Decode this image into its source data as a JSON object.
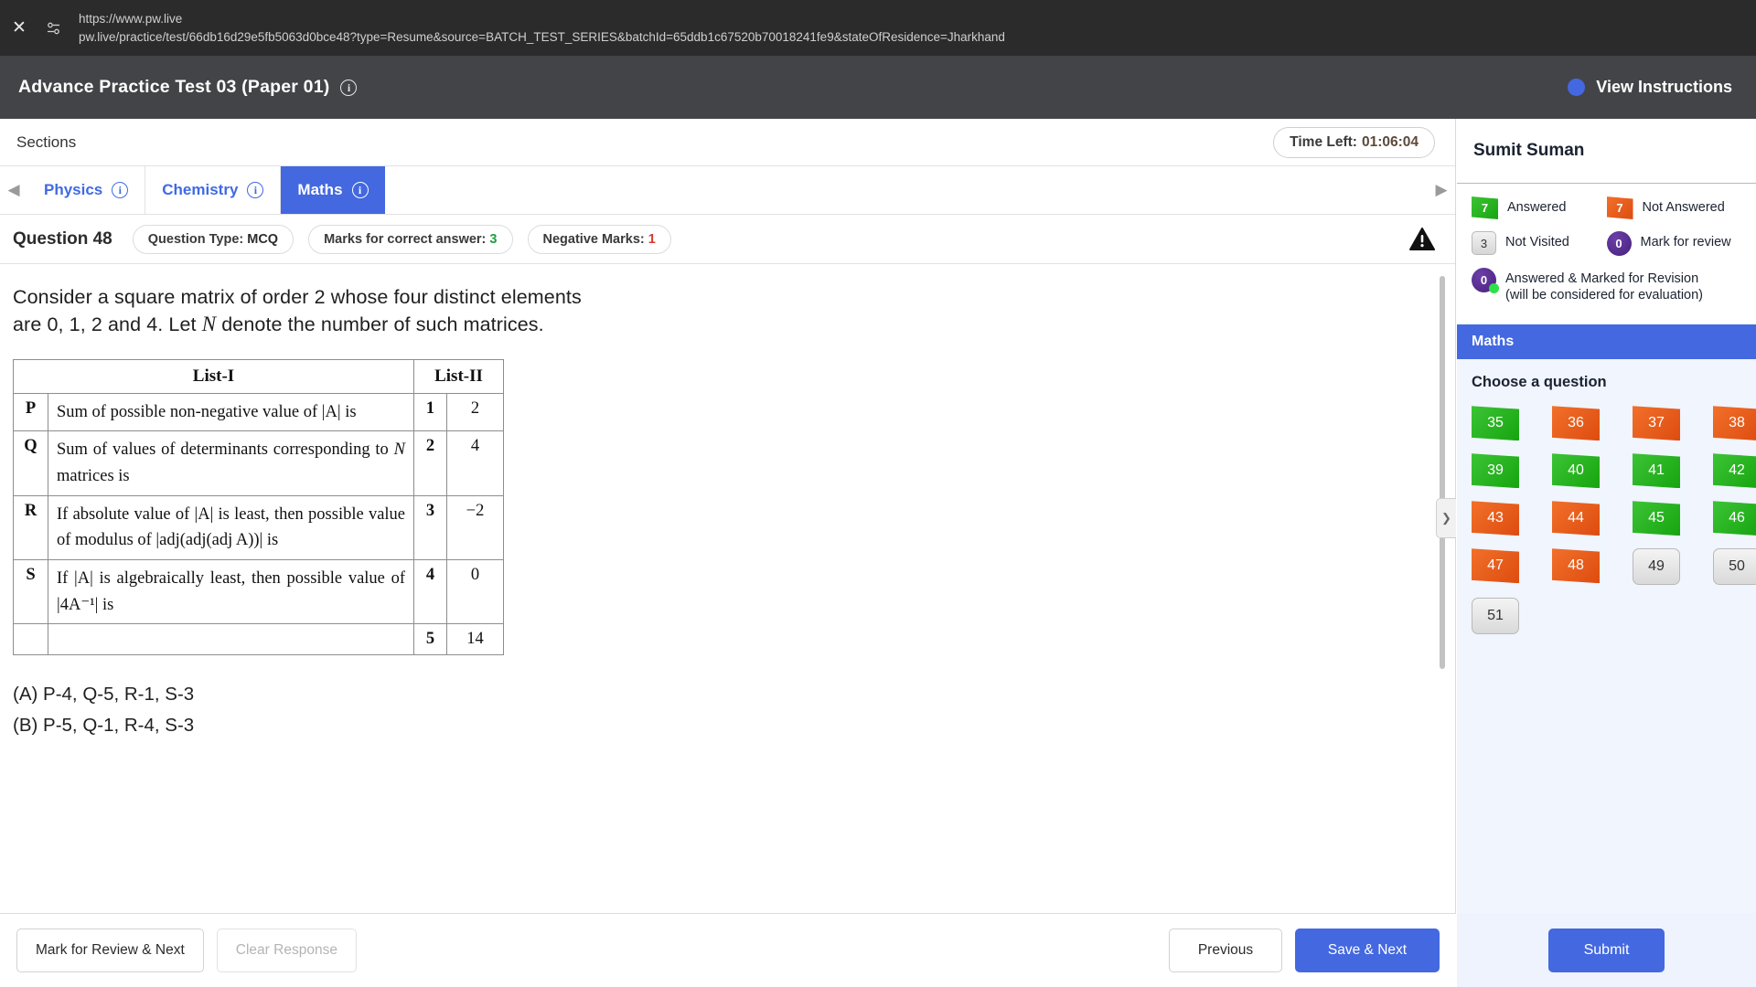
{
  "browser": {
    "close_icon": "close-icon",
    "permissions_icon": "site-permissions-icon",
    "host": "https://www.pw.live",
    "url": "pw.live/practice/test/66db16d29e5fb5063d0bce48?type=Resume&source=BATCH_TEST_SERIES&batchId=65ddb1c67520b70018241fe9&stateOfResidence=Jharkhand"
  },
  "header": {
    "title": "Advance Practice Test 03 (Paper 01)",
    "info_icon": "info-icon",
    "view_instructions": "View Instructions"
  },
  "sections": {
    "label": "Sections",
    "time_left_label": "Time Left:",
    "time_left_value": "01:06:04",
    "prev_arrow_icon": "chevron-left-icon",
    "next_arrow_icon": "chevron-right-icon",
    "tabs": [
      {
        "label": "Physics",
        "active": false
      },
      {
        "label": "Chemistry",
        "active": false
      },
      {
        "label": "Maths",
        "active": true
      }
    ]
  },
  "question_meta": {
    "number": "Question 48",
    "type_label": "Question Type:",
    "type_value": "MCQ",
    "marks_label": "Marks for correct answer:",
    "marks_value": "3",
    "negative_label": "Negative Marks:",
    "negative_value": "1",
    "warning_icon": "warning-triangle-icon"
  },
  "question": {
    "stem_part1": "Consider a square matrix  of order 2 whose four distinct elements are 0, 1, 2 and 4. Let ",
    "stem_symbol": "N",
    "stem_part2": " denote the number of such matrices.",
    "table": {
      "head_left": "List-I",
      "head_right": "List-II",
      "rows": [
        {
          "key": "P",
          "desc_a": "Sum of possible non-negative value of ",
          "desc_sym": "|A|",
          "desc_b": " is",
          "num": "1",
          "val": "2"
        },
        {
          "key": "Q",
          "desc_a": "Sum of values of determinants corresponding to ",
          "desc_sym": "N",
          "desc_b": " matrices is",
          "num": "2",
          "val": "4"
        },
        {
          "key": "R",
          "desc_a": "If absolute value of ",
          "desc_sym": "|A|",
          "desc_b": " is least, then possible value of modulus of |adj(adj(adj A))| is",
          "num": "3",
          "val": "−2"
        },
        {
          "key": "S",
          "desc_a": "If ",
          "desc_sym": "|A|",
          "desc_b": " is algebraically least, then possible value of |4A⁻¹| is",
          "num": "4",
          "val": "0"
        },
        {
          "key": "",
          "desc_a": "",
          "desc_sym": "",
          "desc_b": "",
          "num": "5",
          "val": "14"
        }
      ]
    },
    "options": [
      "(A) P-4, Q-5, R-1, S-3",
      "(B) P-5, Q-1, R-4, S-3"
    ]
  },
  "sidebar": {
    "user_name": "Sumit Suman",
    "legend": [
      {
        "count": "7",
        "label": "Answered",
        "style": "green-flag"
      },
      {
        "count": "7",
        "label": "Not Answered",
        "style": "orange-flag"
      },
      {
        "count": "3",
        "label": "Not Visited",
        "style": "grey-square"
      },
      {
        "count": "0",
        "label": "Mark for review",
        "style": "purple-circle"
      },
      {
        "count": "0",
        "label": "Answered & Marked for Revision (will be considered for evaluation)",
        "style": "purple-circle-dot"
      }
    ],
    "section_title": "Maths",
    "choose_label": "Choose a question",
    "questions": [
      {
        "n": "35",
        "state": "answered"
      },
      {
        "n": "36",
        "state": "notanswered"
      },
      {
        "n": "37",
        "state": "notanswered"
      },
      {
        "n": "38",
        "state": "notanswered"
      },
      {
        "n": "39",
        "state": "answered"
      },
      {
        "n": "40",
        "state": "answered"
      },
      {
        "n": "41",
        "state": "answered"
      },
      {
        "n": "42",
        "state": "answered"
      },
      {
        "n": "43",
        "state": "notanswered"
      },
      {
        "n": "44",
        "state": "notanswered"
      },
      {
        "n": "45",
        "state": "answered"
      },
      {
        "n": "46",
        "state": "answered"
      },
      {
        "n": "47",
        "state": "notanswered"
      },
      {
        "n": "48",
        "state": "notanswered"
      },
      {
        "n": "49",
        "state": "notvisited"
      },
      {
        "n": "50",
        "state": "notvisited"
      },
      {
        "n": "51",
        "state": "notvisited"
      }
    ]
  },
  "footer": {
    "mark_review_next": "Mark for Review & Next",
    "clear_response": "Clear Response",
    "previous": "Previous",
    "save_next": "Save & Next",
    "submit": "Submit"
  },
  "colors": {
    "accent": "#4368e0",
    "answered": "#2cb82c",
    "not_answered": "#e8581c",
    "not_visited": "#d9d9d9",
    "marked": "#56309a",
    "positive_marks": "#1e9e3e",
    "negative_marks": "#d33b2c",
    "header_bg": "#434447",
    "url_bg": "#2b2b2b"
  }
}
